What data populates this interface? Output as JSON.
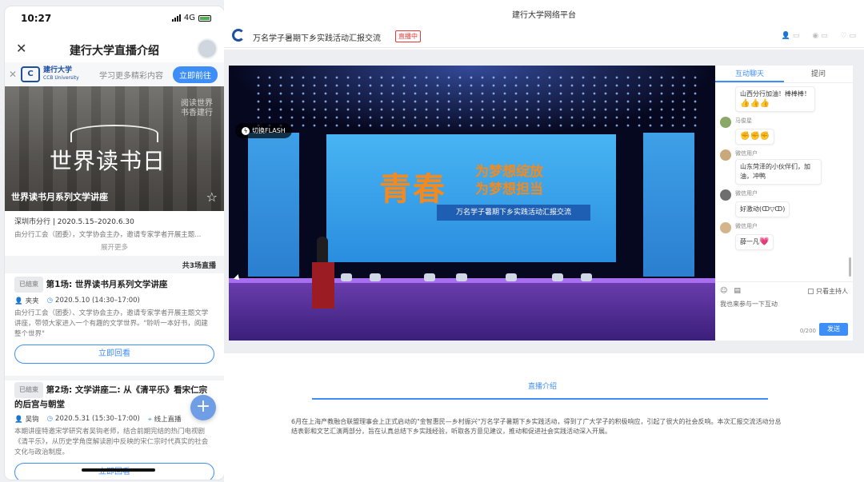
{
  "phone": {
    "status": {
      "time": "10:27",
      "network": "4G"
    },
    "nav": {
      "title": "建行大学直播介绍",
      "close": "✕"
    },
    "banner": {
      "logo_name": "建行大学",
      "logo_en": "CCB University",
      "tagline": "学习更多精彩内容",
      "button": "立即前往"
    },
    "hero": {
      "big_text": "世界读书日",
      "side_text_1": "阅读世界",
      "side_text_2": "书香建行",
      "caption": "世界读书月系列文学讲座"
    },
    "info": {
      "date": "深圳市分行 | 2020.5.15–2020.6.30",
      "desc": "由分行工会（团委），文学协会主办，邀请专家学者开展主题...",
      "expand": "展开更多"
    },
    "count": "共3场直播",
    "sessions": [
      {
        "status": "已结束",
        "title": "第1场: 世界读书月系列文学讲座",
        "speaker": "夹夹",
        "time": "2020.5.10 (14:30–17:00)",
        "desc": "由分行工会（团委）、文学协会主办，邀请专家学者开展主题文学讲座，带领大家进入一个有趣的文学世界。\"聆听一本好书，阅建整个世界\"",
        "button": "立即回看"
      },
      {
        "status": "已结束",
        "title": "第2场: 文学讲座二: 从《清平乐》看宋仁宗的后宫与朝堂",
        "speaker": "吴钩",
        "time": "2020.5.31 (15:30–17:00)",
        "location": "线上直播",
        "desc": "本期讲座特邀宋学研究者吴钩老师，结合前期完结的热门电视剧《清平乐》，从历史学角度解读剧中反映的宋仁宗时代真实的社会文化与政治制度。",
        "button": "立即回看"
      }
    ]
  },
  "web": {
    "window_title": "建行大学网络平台",
    "page_title": "万名学子暑期下乡实践活动汇报交流",
    "live_badge": "直播中",
    "stage": {
      "flash_button": "切换FLASH",
      "slogan_big": "青春",
      "slogan_1": "为梦想绽放",
      "slogan_2": "为梦想担当",
      "band": "万名学子暑期下乡实践活动汇报交流"
    },
    "chat": {
      "tabs": [
        "互动聊天",
        "提问"
      ],
      "messages": [
        {
          "name": "",
          "text": "山西分行加油！棒棒棒！",
          "emoji": "👍👍👍"
        },
        {
          "name": "马俊星",
          "text": "",
          "emoji": "✊✊✊"
        },
        {
          "name": "微信用户",
          "text": "山东菏泽的小伙伴们，加油，冲鸭",
          "emoji": ""
        },
        {
          "name": "微信用户",
          "text": "好激动(ↀ▽ↀ)",
          "emoji": ""
        },
        {
          "name": "微信用户",
          "text": "薛一凡",
          "emoji": "💗"
        }
      ],
      "host_only": "只看主持人",
      "hint": "我也来参与一下互动",
      "counter": "0/200",
      "send": "发送"
    },
    "intro": {
      "tab": "直播介绍",
      "text": "6月在上海产教融合联盟理事会上正式启动的\"金智惠民—乡村振兴\"万名学子暑期下乡实践活动，得到了广大学子的积极响应，引起了很大的社会反响。本次汇报交流活动分总结表彰和文艺汇演两部分，旨在认真总结下乡实践经验，听取各方意见建议，推动和促进社会实践活动深入开展。"
    }
  }
}
